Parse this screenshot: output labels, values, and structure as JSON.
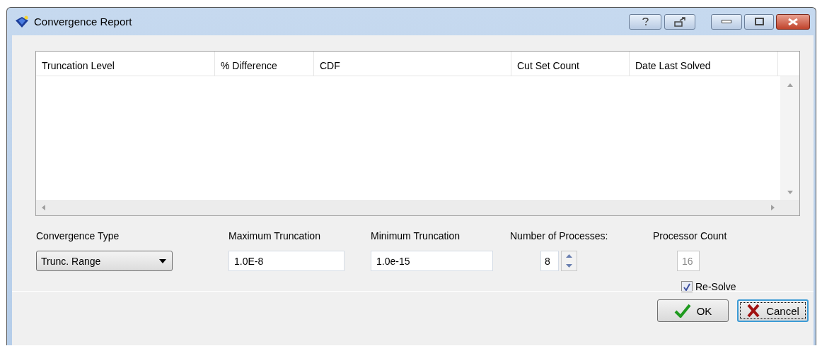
{
  "window": {
    "title": "Convergence Report"
  },
  "table": {
    "columns": [
      "Truncation Level",
      "% Difference",
      "CDF",
      "Cut Set Count",
      "Date Last Solved"
    ]
  },
  "controls": [
    {
      "kind": "dropdown",
      "label": "Convergence  Type",
      "value": "Trunc. Range"
    },
    {
      "kind": "text",
      "label": "Maximum Truncation",
      "value": "1.0E-8"
    },
    {
      "kind": "text",
      "label": "Minimum Truncation",
      "value": "1.0e-15"
    },
    {
      "kind": "spinner",
      "label": "Number of Processes:",
      "value": "8"
    },
    {
      "kind": "readonly",
      "label": "Processor Count",
      "value": "16",
      "disabled": true
    }
  ],
  "checkbox": {
    "label": "Re-Solve",
    "checked": true
  },
  "buttons": [
    {
      "kind": "ok",
      "label": "OK",
      "focused": false
    },
    {
      "kind": "cancel",
      "label": "Cancel",
      "focused": true
    }
  ]
}
